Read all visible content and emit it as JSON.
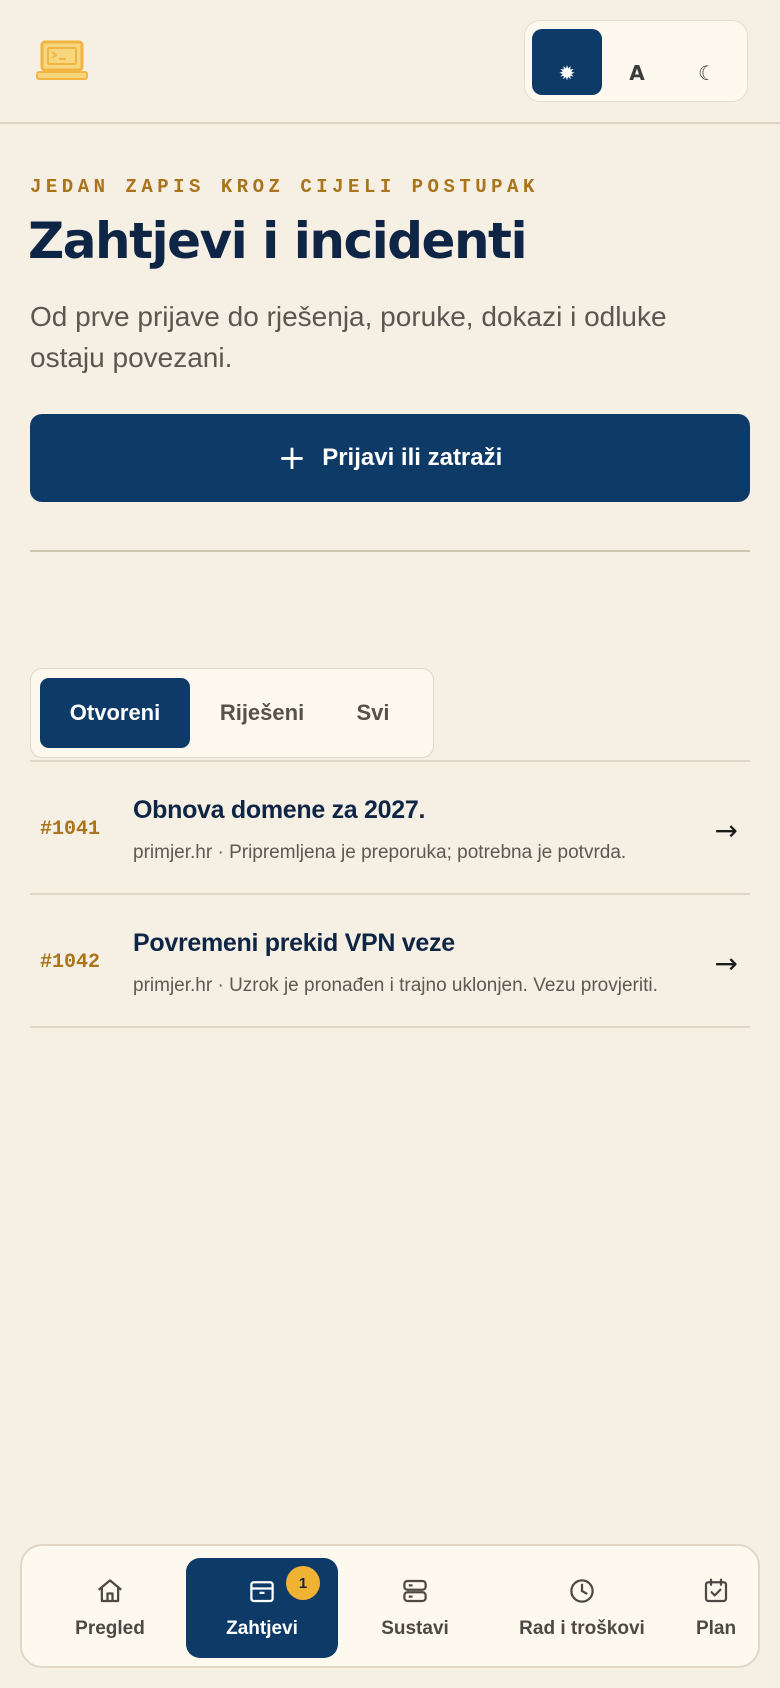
{
  "header": {
    "logo_icon": "terminal-laptop-icon",
    "theme_options": [
      {
        "icon": "sun-icon",
        "label": "✹",
        "active": true
      },
      {
        "icon": "auto-icon",
        "label": "A",
        "active": false
      },
      {
        "icon": "moon-icon",
        "label": "☾",
        "active": false
      }
    ]
  },
  "hero": {
    "eyebrow": "JEDAN ZAPIS KROZ CIJELI POSTUPAK",
    "title": "Zahtjevi i incidenti",
    "subtitle": "Od prve prijave do rješenja, poruke, dokazi i odluke ostaju povezani.",
    "primary_button": {
      "icon": "plus-icon",
      "label": "Prijavi ili zatraži"
    }
  },
  "filter_tabs": [
    {
      "label": "Otvoreni",
      "active": true
    },
    {
      "label": "Riješeni",
      "active": false
    },
    {
      "label": "Svi",
      "active": false
    }
  ],
  "requests": [
    {
      "id": "#1041",
      "title": "Obnova domene za 2027.",
      "meta": "primjer.hr · Pripremljena je preporuka; potrebna je potvrda."
    },
    {
      "id": "#1042",
      "title": "Povremeni prekid VPN veze",
      "meta": "primjer.hr · Uzrok je pronađen i trajno uklonjen. Vezu provjeriti."
    }
  ],
  "bottom_nav": [
    {
      "icon": "home-icon",
      "label": "Pregled",
      "active": false
    },
    {
      "icon": "inbox-icon",
      "label": "Zahtjevi",
      "active": true,
      "badge": "1"
    },
    {
      "icon": "server-icon",
      "label": "Sustavi",
      "active": false
    },
    {
      "icon": "clock-icon",
      "label": "Rad i troškovi",
      "active": false
    },
    {
      "icon": "calendar-check-icon",
      "label": "Plan",
      "active": false
    }
  ],
  "colors": {
    "background": "#f6efe4",
    "primary": "#0d3a67",
    "accent": "#a9741a",
    "badge": "#f0b233",
    "logo": "#f2c15c"
  }
}
